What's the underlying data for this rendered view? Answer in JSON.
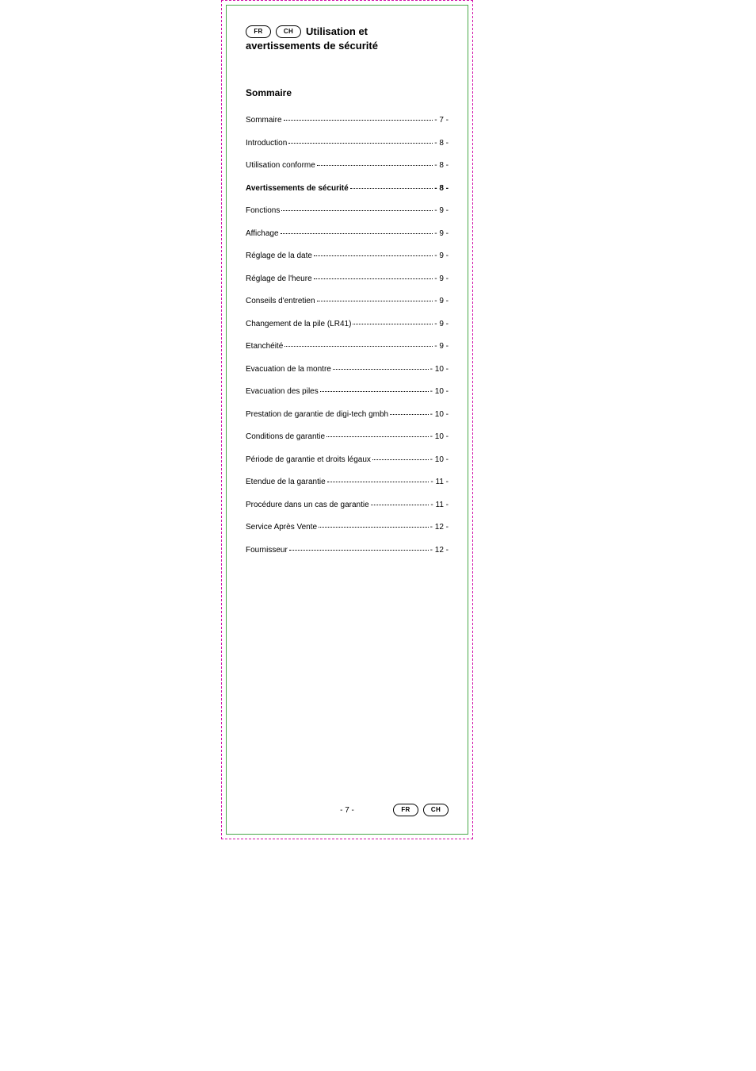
{
  "lang_badges": {
    "header": [
      "FR",
      "CH"
    ],
    "footer": [
      "FR",
      "CH"
    ]
  },
  "title_line1_tail": "Utilisation et",
  "title_line2": "avertissements de sécurité",
  "section_heading": "Sommaire",
  "toc": [
    {
      "label": "Sommaire",
      "page": "- 7 -",
      "bold": false
    },
    {
      "label": "Introduction",
      "page": "- 8 -",
      "bold": false
    },
    {
      "label": "Utilisation conforme",
      "page": "- 8 -",
      "bold": false
    },
    {
      "label": "Avertissements de sécurité",
      "page": "- 8 -",
      "bold": true
    },
    {
      "label": "Fonctions",
      "page": "- 9 -",
      "bold": false
    },
    {
      "label": "Affichage",
      "page": "- 9 -",
      "bold": false
    },
    {
      "label": "Réglage de la date",
      "page": "- 9 -",
      "bold": false
    },
    {
      "label": "Réglage de l'heure",
      "page": "- 9 -",
      "bold": false
    },
    {
      "label": "Conseils d'entretien",
      "page": "- 9 -",
      "bold": false
    },
    {
      "label": "Changement de la pile (LR41)",
      "page": "- 9 -",
      "bold": false
    },
    {
      "label": "Etanchéité",
      "page": "- 9 -",
      "bold": false
    },
    {
      "label": "Evacuation de la montre",
      "page": "- 10 -",
      "bold": false
    },
    {
      "label": "Evacuation des piles",
      "page": "- 10 -",
      "bold": false
    },
    {
      "label": "Prestation de garantie de digi-tech gmbh",
      "page": "- 10 -",
      "bold": false
    },
    {
      "label": "Conditions de garantie",
      "page": "- 10 -",
      "bold": false
    },
    {
      "label": "Période de garantie et droits légaux",
      "page": "- 10 -",
      "bold": false
    },
    {
      "label": "Etendue de la garantie",
      "page": "- 11 -",
      "bold": false
    },
    {
      "label": "Procédure dans un cas de garantie",
      "page": "- 11 -",
      "bold": false
    },
    {
      "label": "Service Après Vente",
      "page": "- 12 -",
      "bold": false
    },
    {
      "label": "Fournisseur",
      "page": "- 12 -",
      "bold": false
    }
  ],
  "footer_page": "- 7 -"
}
